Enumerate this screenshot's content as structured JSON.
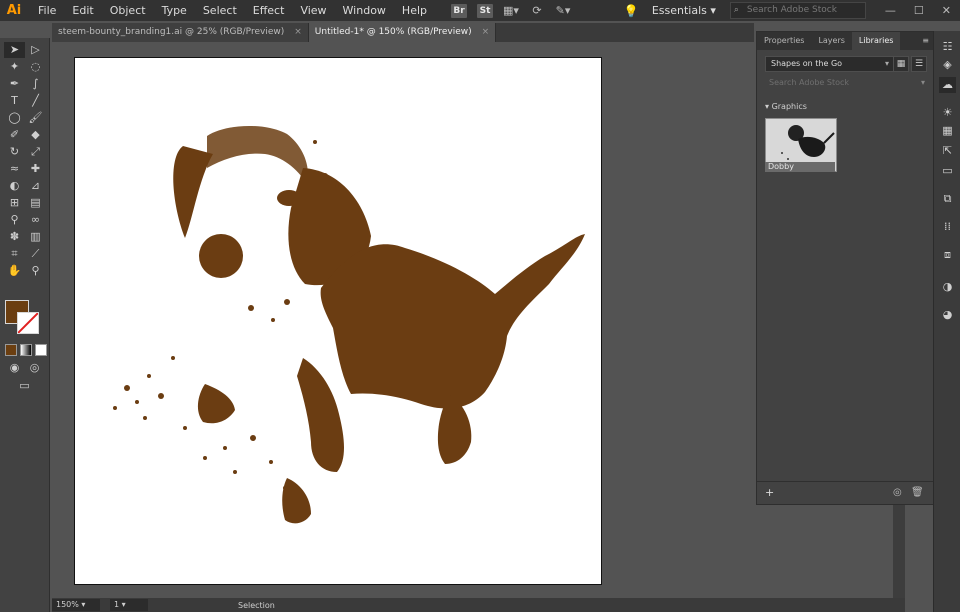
{
  "app": {
    "logo": "Ai",
    "accent": "#ff9a00"
  },
  "menu": {
    "items": [
      "File",
      "Edit",
      "Object",
      "Type",
      "Select",
      "Effect",
      "View",
      "Window",
      "Help"
    ],
    "bridge_icon": "Br",
    "stock_icon": "St"
  },
  "workspace": {
    "label": "Essentials",
    "stock_search_placeholder": "Search Adobe Stock"
  },
  "tabs": [
    {
      "label": "steem-bounty_branding1.ai @ 25% (RGB/Preview)",
      "active": false
    },
    {
      "label": "Untitled-1* @ 150% (RGB/Preview)",
      "active": true
    }
  ],
  "tab_close_glyph": "×",
  "panel": {
    "tabs": [
      "Properties",
      "Layers",
      "Libraries"
    ],
    "active_tab": "Libraries",
    "library": "Shapes on the Go",
    "search_placeholder": "Search Adobe Stock",
    "group": "Graphics",
    "asset_label": "Dobby"
  },
  "colors": {
    "fill": "#6b3e10",
    "artwork": "#6b3d12",
    "stroke": "#ffffff"
  },
  "status": {
    "zoom": "150%",
    "artboard": "1",
    "mode": "Selection"
  },
  "window_controls": {
    "minimize": "—",
    "maximize": "☐",
    "close": "✕"
  }
}
